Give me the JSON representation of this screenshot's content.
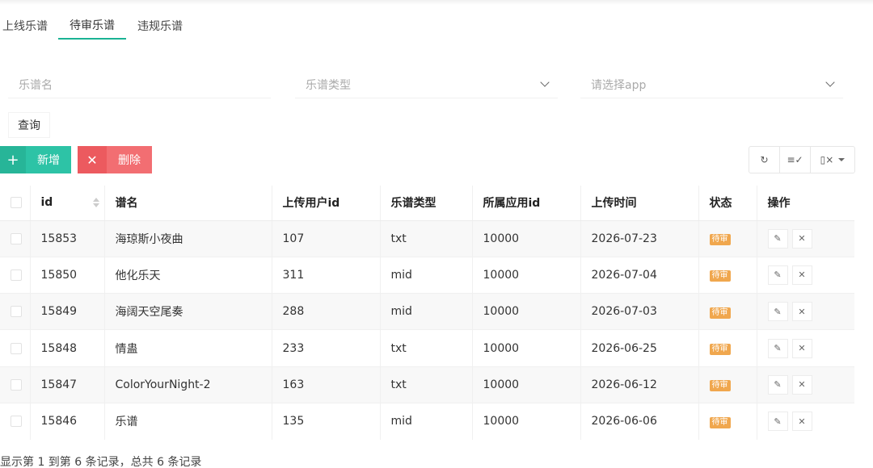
{
  "tabs": [
    {
      "label": "上线乐谱"
    },
    {
      "label": "待审乐谱"
    },
    {
      "label": "违规乐谱"
    }
  ],
  "search": {
    "name_placeholder": "乐谱名",
    "type_placeholder": "乐谱类型",
    "app_placeholder": "请选择app",
    "query_label": "查询"
  },
  "actions": {
    "add_icon": "+",
    "add_label": "新增",
    "delete_icon": "✕",
    "delete_label": "删除"
  },
  "toolbar": {
    "refresh_icon": "↻",
    "columns_icon": "≡✓",
    "export_icon": "▯×"
  },
  "table": {
    "headers": [
      "id",
      "谱名",
      "上传用户id",
      "乐谱类型",
      "所属应用id",
      "上传时间",
      "状态",
      "操作"
    ],
    "rows": [
      {
        "id": "15853",
        "name": "海琼斯小夜曲",
        "user": "107",
        "type": "txt",
        "app": "10000",
        "time": "2026-07-23",
        "status": "待审"
      },
      {
        "id": "15850",
        "name": "他化乐天",
        "user": "311",
        "type": "mid",
        "app": "10000",
        "time": "2026-07-04",
        "status": "待审"
      },
      {
        "id": "15849",
        "name": "海阔天空尾奏",
        "user": "288",
        "type": "mid",
        "app": "10000",
        "time": "2026-07-03",
        "status": "待审"
      },
      {
        "id": "15848",
        "name": "情蛊",
        "user": "233",
        "type": "txt",
        "app": "10000",
        "time": "2026-06-25",
        "status": "待审"
      },
      {
        "id": "15847",
        "name": "ColorYourNight-2",
        "user": "163",
        "type": "txt",
        "app": "10000",
        "time": "2026-06-12",
        "status": "待审"
      },
      {
        "id": "15846",
        "name": "乐谱",
        "user": "135",
        "type": "mid",
        "app": "10000",
        "time": "2026-06-06",
        "status": "待审"
      }
    ],
    "edit_icon": "✎",
    "remove_icon": "✕"
  },
  "footer": {
    "text": "显示第 1 到第 6 条记录，总共 6 条记录"
  },
  "colors": {
    "accent": "#1ab394",
    "add": "#2dc3a6",
    "danger": "#f26e72",
    "badge": "#f0a74e"
  }
}
